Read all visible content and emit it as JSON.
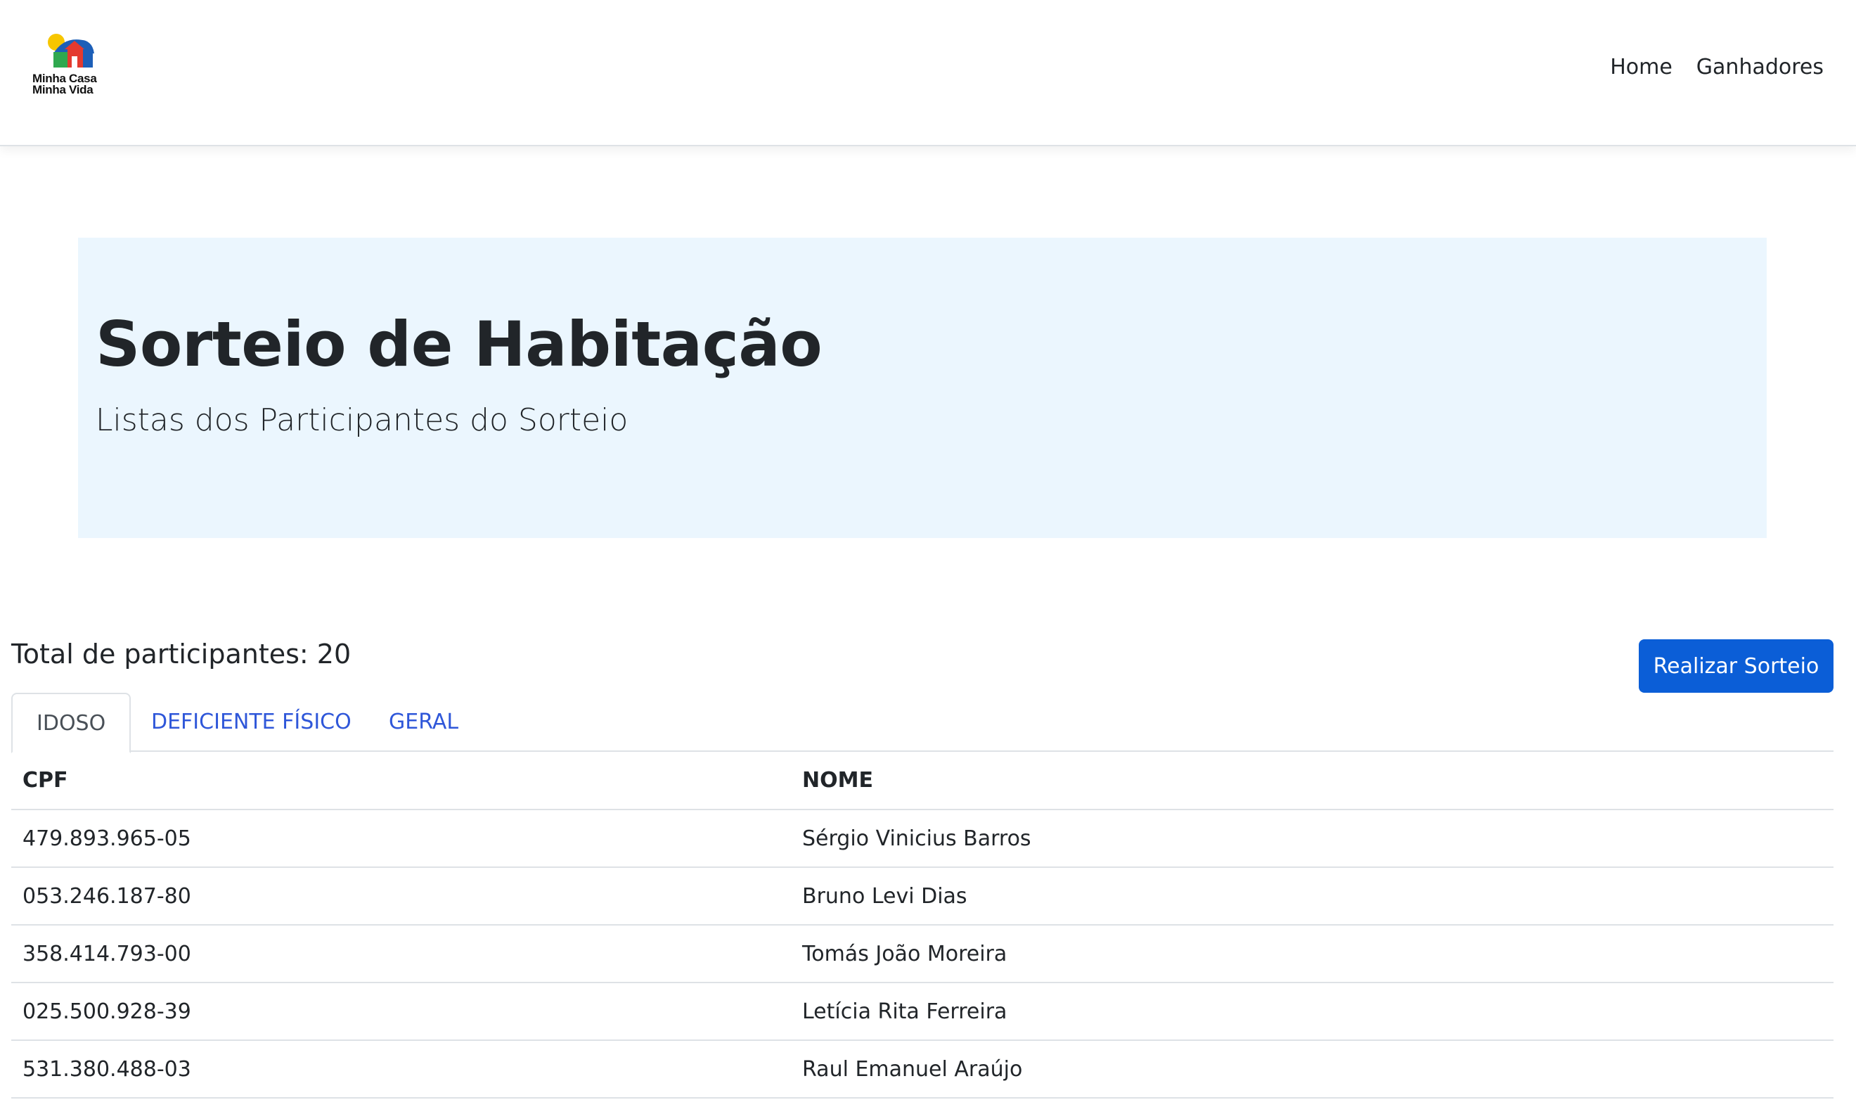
{
  "brand": {
    "line1": "Minha Casa",
    "line2": "Minha Vida",
    "colors": [
      "#f7c600",
      "#1d5fb8",
      "#e43a2f",
      "#2fa84f"
    ]
  },
  "nav": {
    "items": [
      {
        "label": "Home"
      },
      {
        "label": "Ganhadores"
      }
    ]
  },
  "hero": {
    "title": "Sorteio de Habitação",
    "subtitle": "Listas dos Participantes do Sorteio"
  },
  "summary": {
    "total_label": "Total de participantes: 20",
    "action_label": "Realizar Sorteio"
  },
  "tabs": [
    {
      "label": "IDOSO",
      "active": true
    },
    {
      "label": "DEFICIENTE FÍSICO",
      "active": false
    },
    {
      "label": "GERAL",
      "active": false
    }
  ],
  "table": {
    "headers": [
      "CPF",
      "NOME"
    ],
    "rows": [
      [
        "479.893.965-05",
        "Sérgio Vinicius Barros"
      ],
      [
        "053.246.187-80",
        "Bruno Levi Dias"
      ],
      [
        "358.414.793-00",
        "Tomás João Moreira"
      ],
      [
        "025.500.928-39",
        "Letícia Rita Ferreira"
      ],
      [
        "531.380.488-03",
        "Raul Emanuel Araújo"
      ]
    ]
  },
  "colors": {
    "primary": "#0b5ed7",
    "link": "#2f57d9",
    "hero_bg": "#ebf6fe"
  }
}
